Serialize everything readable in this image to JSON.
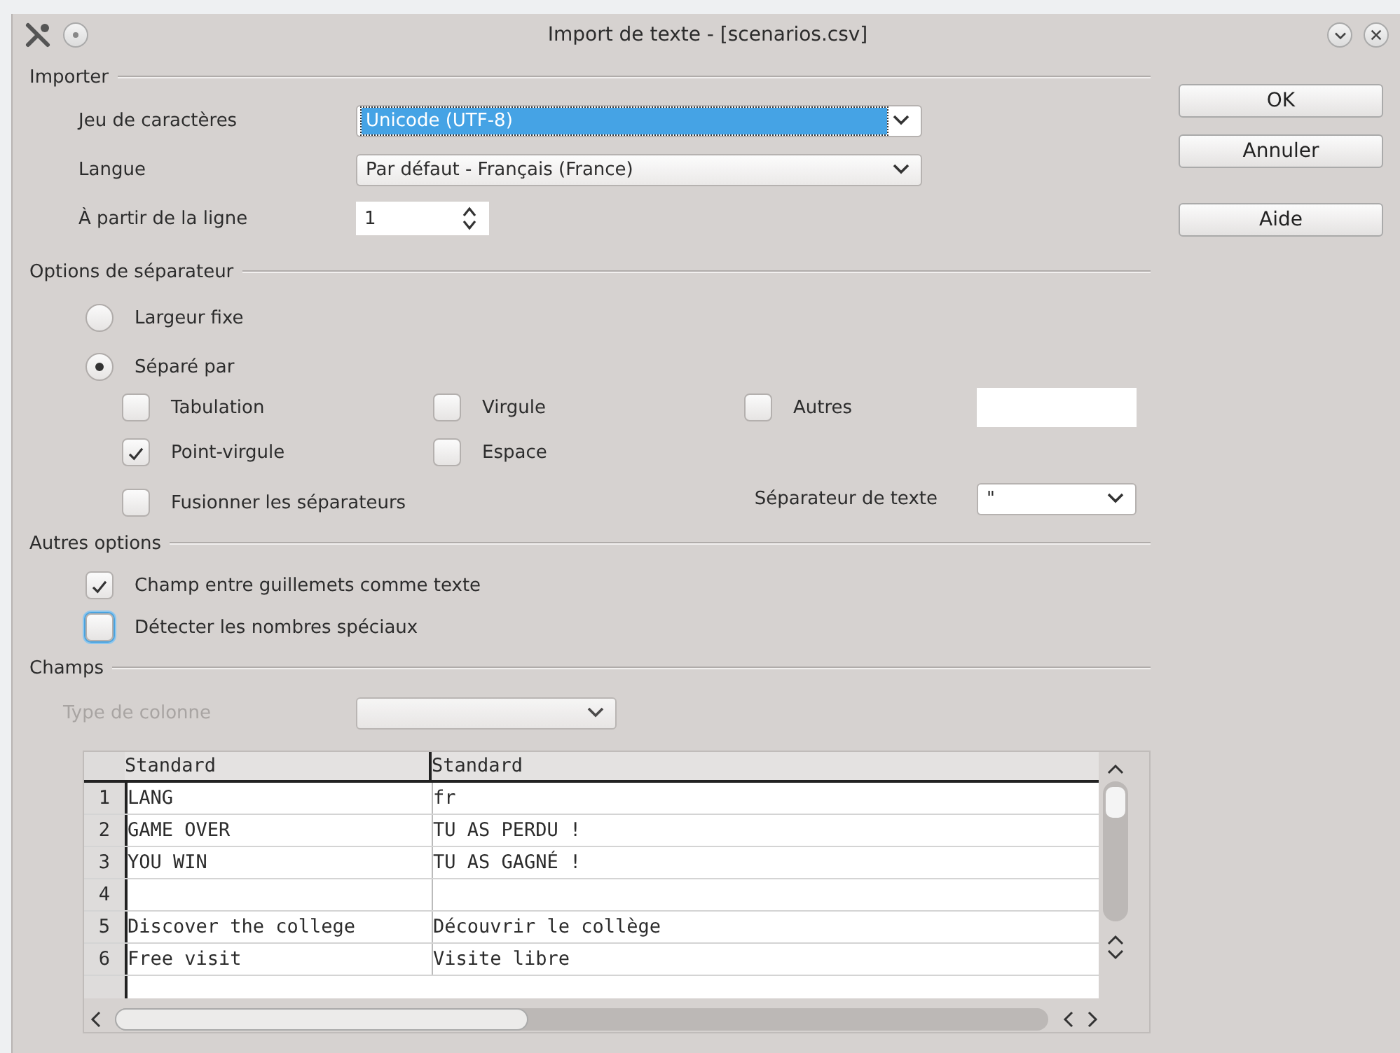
{
  "window": {
    "title": "Import de texte - [scenarios.csv]"
  },
  "buttons": [
    {
      "label": "OK"
    },
    {
      "label": "Annuler"
    },
    {
      "label": "Aide"
    }
  ],
  "importer": {
    "heading": "Importer",
    "charset": {
      "label": "Jeu de caractères",
      "value": "Unicode (UTF-8)",
      "focused": true
    },
    "language": {
      "label": "Langue",
      "value": "Par défaut - Français (France)",
      "focused": false
    },
    "from_row": {
      "label": "À partir de la ligne",
      "value": "1"
    }
  },
  "separator_options": {
    "heading": "Options de séparateur",
    "modes": [
      {
        "label": "Largeur fixe",
        "selected": false
      },
      {
        "label": "Séparé par",
        "selected": true
      }
    ],
    "separators": [
      {
        "label": "Tabulation",
        "checked": false
      },
      {
        "label": "Virgule",
        "checked": false
      },
      {
        "label": "Autres",
        "checked": false
      },
      {
        "label": "Point-virgule",
        "checked": true
      },
      {
        "label": "Espace",
        "checked": false
      },
      {
        "label": "Fusionner les séparateurs",
        "checked": false
      }
    ],
    "text_delimiter": {
      "label": "Séparateur de texte",
      "value": "\""
    }
  },
  "other_options": {
    "heading": "Autres options",
    "options": [
      {
        "label": "Champ entre guillemets comme texte",
        "checked": true,
        "focused": false
      },
      {
        "label": "Détecter les nombres spéciaux",
        "checked": false,
        "focused": true
      }
    ]
  },
  "fields": {
    "heading": "Champs",
    "column_type": {
      "label": "Type de colonne",
      "disabled": true
    },
    "table": {
      "columns": [
        "Standard",
        "Standard"
      ],
      "rows": [
        {
          "number": "1",
          "cells": [
            "LANG",
            "fr"
          ]
        },
        {
          "number": "2",
          "cells": [
            "GAME OVER",
            "TU AS PERDU !"
          ]
        },
        {
          "number": "3",
          "cells": [
            "YOU WIN",
            "TU AS GAGNÉ !"
          ]
        },
        {
          "number": "4",
          "cells": []
        },
        {
          "number": "5",
          "cells": [
            "Discover the college",
            "Découvrir le collège"
          ]
        },
        {
          "number": "6",
          "cells": [
            "Free visit",
            "Visite libre"
          ]
        }
      ]
    }
  }
}
